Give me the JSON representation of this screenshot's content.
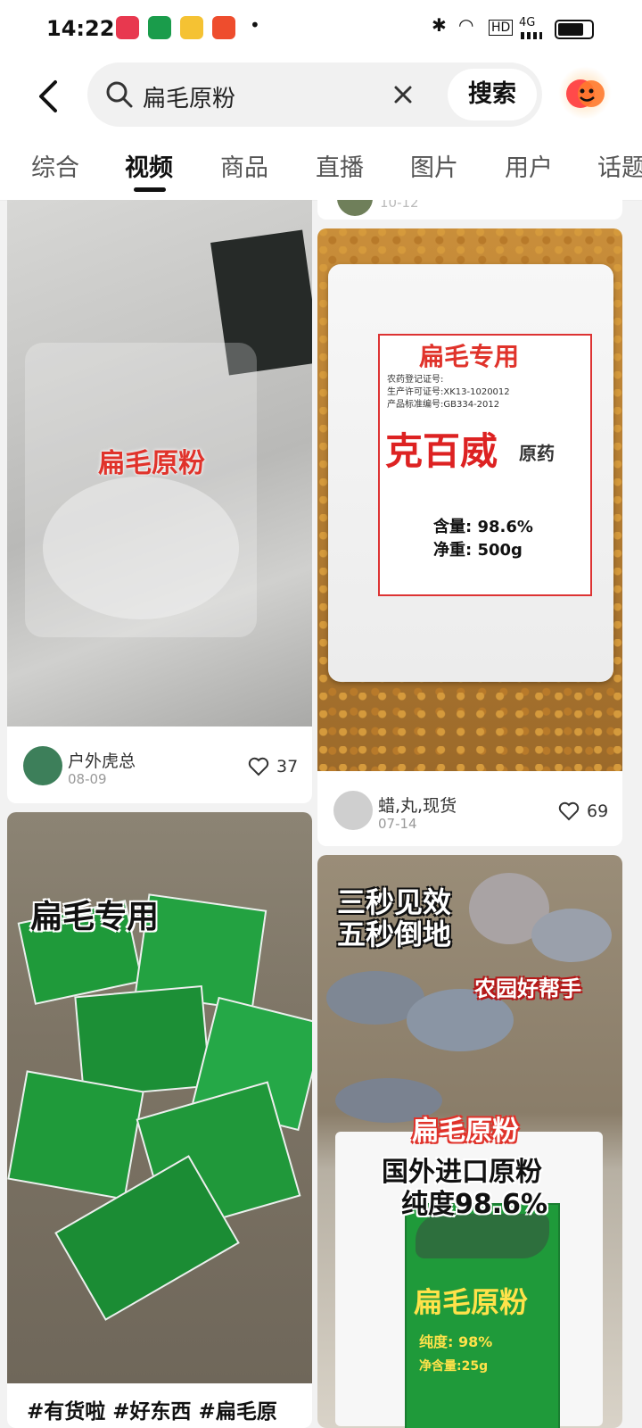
{
  "status": {
    "time": "14:22",
    "network": "4G",
    "hd": "HD"
  },
  "search": {
    "query": "扁毛原粉",
    "button": "搜索"
  },
  "tabs": [
    "综合",
    "视频",
    "商品",
    "直播",
    "图片",
    "用户",
    "话题"
  ],
  "colors": {
    "accent": "#111111",
    "like": "#333333",
    "overlay_red": "#e0332b",
    "bag_green": "#1f9a3a"
  },
  "cards": [
    {
      "overlay": "扁毛原粉",
      "author": "户外虎总",
      "date": "08-09",
      "likes": "37"
    },
    {
      "bag_title": "扁毛专用",
      "bag_lines": [
        "农药登记证号:",
        "生产许可证号:XK13-1020012",
        "产品标准编号:GB334-2012"
      ],
      "bag_name": "克百威",
      "bag_suffix": "原药",
      "bag_content": "含量: 98.6%",
      "bag_weight": "净重: 500g",
      "author": "蜡,丸,现货",
      "date": "07-14",
      "likes": "69"
    },
    {
      "overlay": "扁毛专用",
      "caption": "#有货啦 #好东西 #扁毛原"
    },
    {
      "overlay1": "三秒见效",
      "overlay2": "五秒倒地",
      "overlay3": "农园好帮手",
      "overlay4": "扁毛原粉",
      "overlay5": "国外进口原粉",
      "overlay6": "纯度98.6%",
      "bag_name": "扁毛原粉",
      "bag_purity": "纯度: 98%",
      "bag_weight": "净含量:25g"
    }
  ],
  "partial_card": {
    "date": "10-12"
  }
}
